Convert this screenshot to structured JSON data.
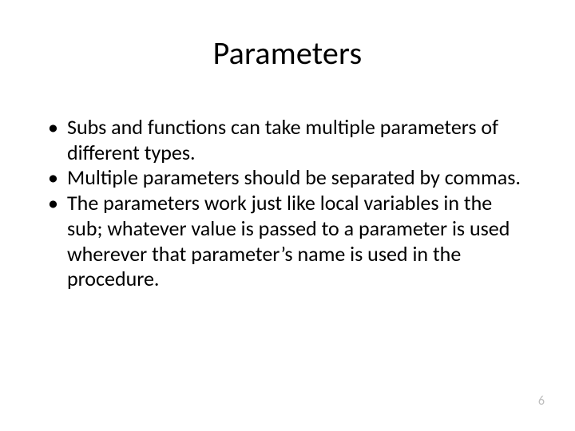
{
  "slide": {
    "title": "Parameters",
    "bullets": [
      "Subs and functions can take multiple parameters of different types.",
      "Multiple parameters should be separated by commas.",
      "The parameters work just like local variables in the sub; whatever value is passed to a parameter is used wherever that parameter’s name is used in the procedure."
    ],
    "page_number": "6"
  }
}
